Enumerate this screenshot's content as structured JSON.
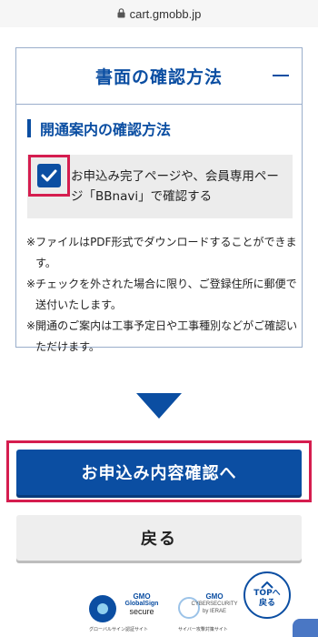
{
  "browser": {
    "url": "cart.gmobb.jp",
    "lock_icon": "lock-icon"
  },
  "section": {
    "title": "書面の確認方法",
    "collapse_icon": "minus-icon",
    "subheading": "開通案内の確認方法",
    "checkbox": {
      "checked": true,
      "label": "お申込み完了ページや、会員専用ページ「BBnavi」で確認する"
    },
    "notes": [
      {
        "mark": "※",
        "text": "ファイルはPDF形式でダウンロードすることができます。"
      },
      {
        "mark": "※",
        "text": "チェックを外された場合に限り、ご登録住所に郵便で送付いたします。"
      },
      {
        "mark": "※",
        "text": "開通のご案内は工事予定日や工事種別などがご確認いただけます。"
      }
    ]
  },
  "actions": {
    "primary_label": "お申込み内容確認へ",
    "back_label": "戻る"
  },
  "footer": {
    "globalsign": {
      "gmo": "GMO",
      "name": "GlobalSign",
      "secure": "secure",
      "caption": "グローバルサイン認証サイト"
    },
    "cyber": {
      "gmo": "GMO",
      "line1": "CYBERSECURITY",
      "line2": "by IERAE",
      "caption": "サイバー攻撃対策サイト"
    },
    "top_button": {
      "top": "TOPへ",
      "back": "戻る"
    }
  },
  "colors": {
    "accent": "#0b4ea2",
    "highlight": "#d51d4f"
  }
}
